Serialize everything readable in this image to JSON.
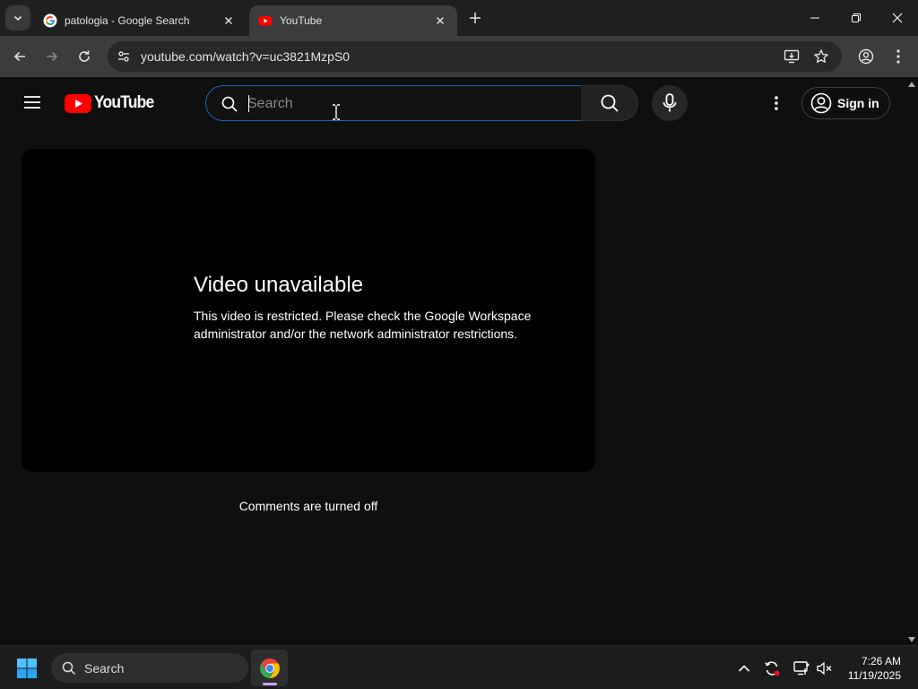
{
  "browser": {
    "tabs": [
      {
        "title": "patologia - Google Search",
        "favicon": "google-g-icon",
        "active": false
      },
      {
        "title": "YouTube",
        "favicon": "youtube-play-icon",
        "active": true
      }
    ],
    "address_bar": {
      "url": "youtube.com/watch?v=uc3821MzpS0"
    }
  },
  "youtube": {
    "logo_text": "YouTube",
    "search": {
      "placeholder": "Search",
      "value": ""
    },
    "sign_in_label": "Sign in",
    "player": {
      "error_title": "Video unavailable",
      "error_message": "This video is restricted. Please check the Google Workspace administrator and/or the network administrator restrictions."
    },
    "comments_status": "Comments are turned off"
  },
  "taskbar": {
    "search_label": "Search",
    "time": "7:26 AM",
    "date": "11/19/2025"
  },
  "colors": {
    "youtube_red": "#ff0000",
    "page_background": "#0f0f0f",
    "search_focus_border": "#1c62b9"
  }
}
